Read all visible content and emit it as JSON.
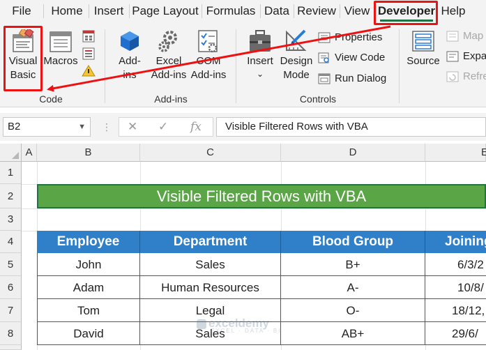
{
  "menu": {
    "tabs": [
      "File",
      "Home",
      "Insert",
      "Page Layout",
      "Formulas",
      "Data",
      "Review",
      "View",
      "Developer",
      "Help"
    ],
    "active_tab": "Developer"
  },
  "ribbon": {
    "code_group": {
      "label": "Code",
      "visual_basic": [
        "Visual",
        "Basic"
      ],
      "macros": "Macros"
    },
    "addins_group": {
      "label": "Add-ins",
      "addins": [
        "Add-",
        "ins"
      ],
      "excel_addins": [
        "Excel",
        "Add-ins"
      ],
      "com_addins": [
        "COM",
        "Add-ins"
      ]
    },
    "controls_group": {
      "label": "Controls",
      "insert": "Insert",
      "design_mode": [
        "Design",
        "Mode"
      ],
      "properties": "Properties",
      "view_code": "View Code",
      "run_dialog": "Run Dialog"
    },
    "xml_group": {
      "source": "Source",
      "map": "Map",
      "expand": "Expan",
      "refresh": "Refre"
    }
  },
  "formula_bar": {
    "name_box": "B2",
    "formula": "Visible Filtered Rows with VBA"
  },
  "grid": {
    "columns": [
      "A",
      "B",
      "C",
      "D",
      "E"
    ],
    "rows": [
      "1",
      "2",
      "3",
      "4",
      "5",
      "6",
      "7",
      "8"
    ],
    "title": "Visible Filtered Rows with VBA",
    "table": {
      "headers": [
        "Employee",
        "Department",
        "Blood Group",
        "Joining"
      ],
      "rows": [
        [
          "John",
          "Sales",
          "B+",
          "6/3/2"
        ],
        [
          "Adam",
          "Human Resources",
          "A-",
          "10/8/"
        ],
        [
          "Tom",
          "Legal",
          "O-",
          "18/12,"
        ],
        [
          "David",
          "Sales",
          "AB+",
          "29/6/"
        ]
      ]
    },
    "watermark": {
      "brand": "exceldemy",
      "tagline": "EXCEL · DATA · BI"
    }
  },
  "colors": {
    "excel_green": "#217346",
    "title_fill": "#5aa545",
    "header_fill": "#2f80c9",
    "annotation_red": "#ee1111"
  }
}
